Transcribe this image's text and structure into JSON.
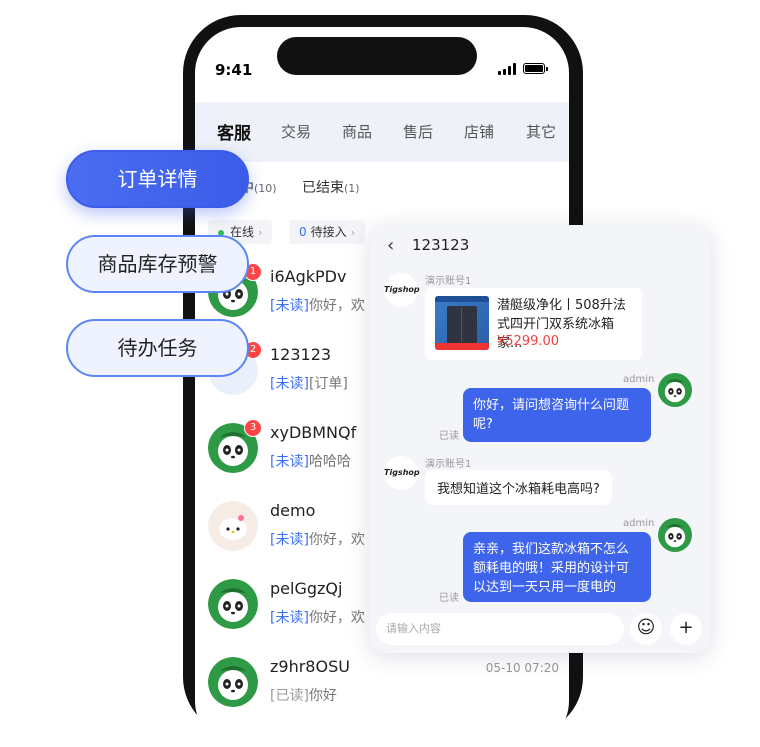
{
  "status_bar": {
    "time": "9:41"
  },
  "top_tabs": [
    "客服",
    "交易",
    "商品",
    "售后",
    "店铺",
    "其它"
  ],
  "sub_tabs": {
    "active": {
      "label": "中",
      "count": "(10)"
    },
    "ended": {
      "label": "已结束",
      "count": "(1)"
    }
  },
  "filters": {
    "online": "在线",
    "pending_count": "0",
    "pending": "待接入"
  },
  "chat_list": [
    {
      "name": "i6AgkPDv",
      "status": "[未读]",
      "preview": "你好，欢",
      "badge": "1",
      "time": "",
      "avatar": "panda"
    },
    {
      "name": "123123",
      "status": "[未读]",
      "preview": "[订单]",
      "badge": "2",
      "time": "",
      "avatar": "blank"
    },
    {
      "name": "xyDBMNQf",
      "status": "[未读]",
      "preview": "哈哈哈",
      "badge": "3",
      "time": "",
      "avatar": "panda"
    },
    {
      "name": "demo",
      "status": "[未读]",
      "preview": "你好，欢",
      "badge": "",
      "time": "",
      "avatar": "kitty"
    },
    {
      "name": "pelGgzQj",
      "status": "[未读]",
      "preview": "你好，欢",
      "badge": "",
      "time": "",
      "avatar": "panda"
    },
    {
      "name": "z9hr8OSU",
      "status": "[已读]",
      "preview": "你好",
      "badge": "",
      "time": "05-10 07:20",
      "avatar": "panda"
    }
  ],
  "chat_card": {
    "title": "123123",
    "back_icon": "chevron-left-icon",
    "shop_logo": "Tigshop",
    "sender_demo": "演示账号1",
    "product": {
      "name": "潜艇级净化丨508升法式四开门双系统冰箱家...",
      "price": "¥5299.00"
    },
    "admin_label": "admin",
    "read_label": "已读",
    "msg_admin_1": "你好，请问想咨询什么问题呢?",
    "msg_user_1": "我想知道这个冰箱耗电高吗?",
    "msg_admin_2": "亲亲，我们这款冰箱不怎么额耗电的哦！采用的设计可以达到一天只用一度电的",
    "input_placeholder": "请输入内容",
    "emoji_icon": "☺",
    "plus_icon": "+"
  },
  "feature_pills": [
    "订单详情",
    "商品库存预警",
    "待办任务"
  ],
  "colors": {
    "accent": "#3e64ec",
    "badge": "#ff4444",
    "unread": "#3b6ff5",
    "price": "#f04040"
  }
}
